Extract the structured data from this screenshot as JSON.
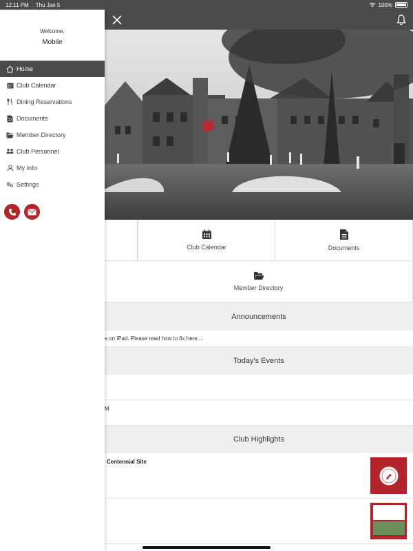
{
  "status_bar": {
    "time": "12:11 PM",
    "date": "Thu Jan 5",
    "battery": "100%"
  },
  "sidebar": {
    "welcome_label": "Welcome,",
    "user_name": "Mobile",
    "items": [
      {
        "label": "Home",
        "icon": "home-icon",
        "active": true
      },
      {
        "label": "Club Calendar",
        "icon": "calendar-icon"
      },
      {
        "label": "Dining Reservations",
        "icon": "utensils-icon"
      },
      {
        "label": "Documents",
        "icon": "document-icon"
      },
      {
        "label": "Member Directory",
        "icon": "folder-icon"
      },
      {
        "label": "Club Personnel",
        "icon": "people-icon"
      },
      {
        "label": "My Info",
        "icon": "user-icon"
      },
      {
        "label": "Settings",
        "icon": "gear-icon"
      }
    ]
  },
  "tiles": {
    "club_calendar": "Club Calendar",
    "documents": "Documents",
    "member_directory": "Member Directory"
  },
  "announcements": {
    "heading": "Announcements",
    "text": "s on iPad. Please read how to fix here..."
  },
  "events": {
    "heading": "Today's Events",
    "row2_text": "M"
  },
  "highlights": {
    "heading": "Club Highlights",
    "items": [
      {
        "title": "Centennial Site"
      },
      {
        "title": ""
      }
    ]
  },
  "colors": {
    "accent": "#b3232a",
    "header": "#4a4a4a"
  }
}
